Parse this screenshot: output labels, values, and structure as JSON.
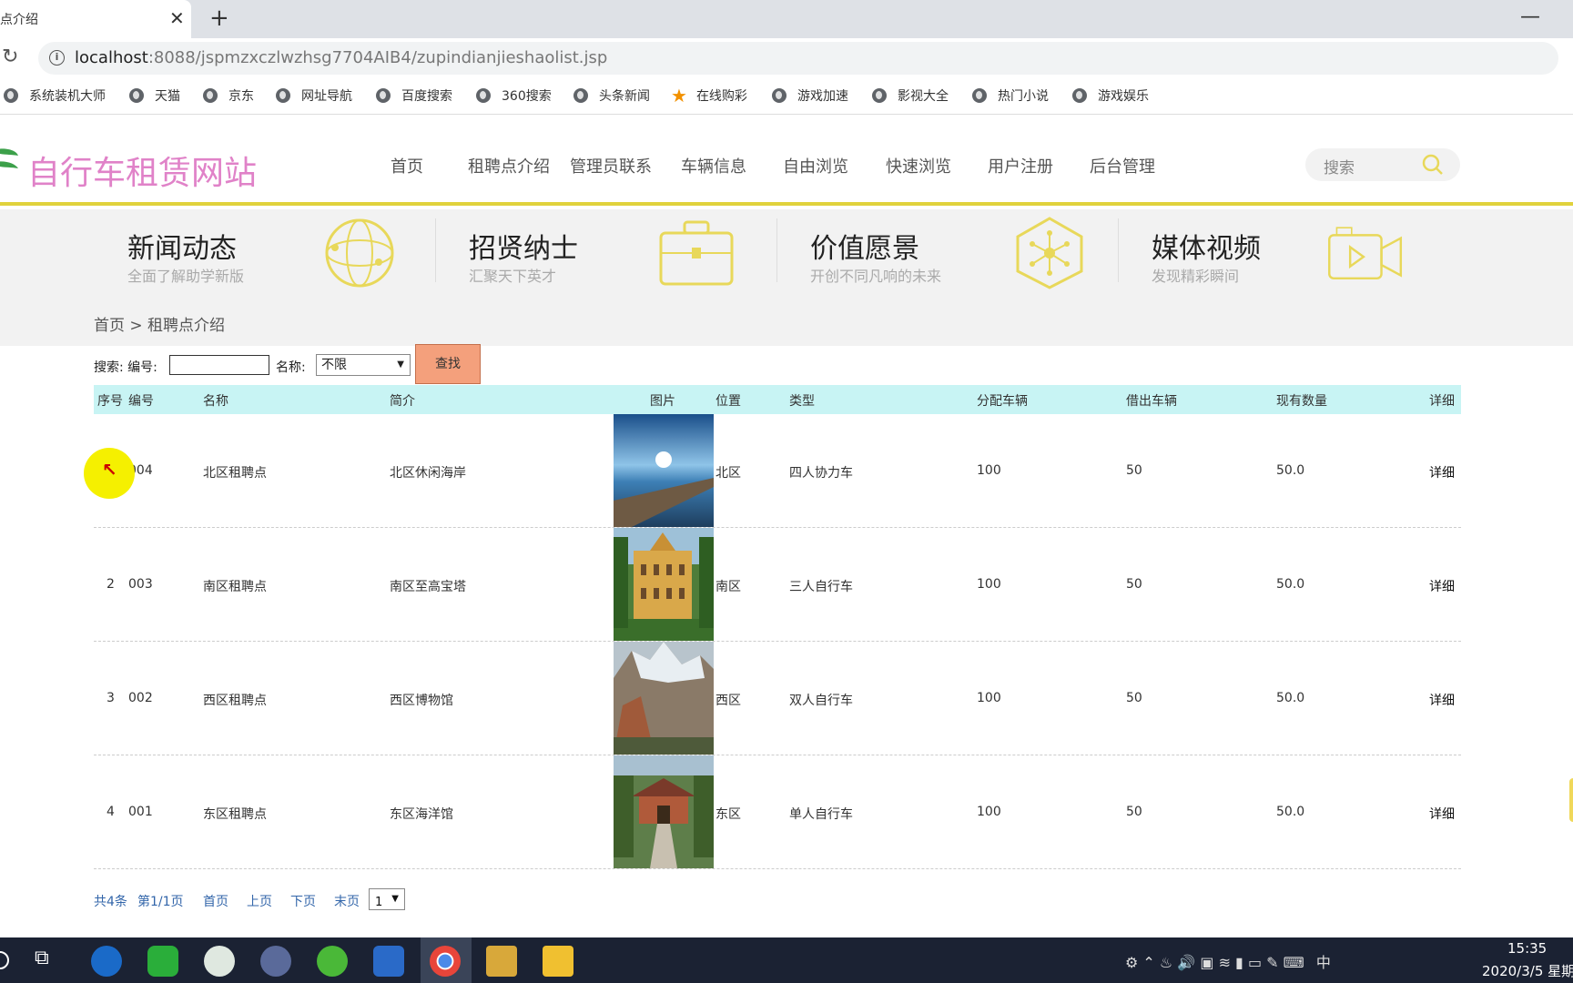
{
  "browser": {
    "tab_title": "点介绍",
    "url_host": "localhost",
    "url_rest": ":8088/jspmzxczlwzhsg7704AIB4/zupindianjieshaolist.jsp",
    "bookmarks": [
      "系统装机大师",
      "天猫",
      "京东",
      "网址导航",
      "百度搜索",
      "360搜索",
      "头条新闻",
      "在线购彩",
      "游戏加速",
      "影视大全",
      "热门小说",
      "游戏娱乐"
    ]
  },
  "site": {
    "title": "自行车租赁网站",
    "nav": [
      "首页",
      "租聘点介绍",
      "管理员联系",
      "车辆信息",
      "自由浏览",
      "快速浏览",
      "用户注册",
      "后台管理"
    ],
    "search_placeholder": "搜索"
  },
  "features": [
    {
      "title": "新闻动态",
      "subtitle": "全面了解助学新版",
      "icon": "globe-icon"
    },
    {
      "title": "招贤纳士",
      "subtitle": "汇聚天下英才",
      "icon": "briefcase-icon"
    },
    {
      "title": "价值愿景",
      "subtitle": "开创不同凡响的未来",
      "icon": "network-icon"
    },
    {
      "title": "媒体视频",
      "subtitle": "发现精彩瞬间",
      "icon": "video-camera-icon"
    }
  ],
  "breadcrumb": "首页 > 租聘点介绍",
  "search_form": {
    "label": "搜索: 编号:",
    "code_value": "",
    "name_label": "名称:",
    "name_selected": "不限",
    "button": "查找"
  },
  "table": {
    "headers": [
      "序号",
      "编号",
      "名称",
      "简介",
      "图片",
      "位置",
      "类型",
      "分配车辆",
      "借出车辆",
      "现有数量",
      "详细"
    ],
    "rows": [
      {
        "index": "1",
        "code": "004",
        "name": "北区租聘点",
        "intro": "北区休闲海岸",
        "location": "北区",
        "type": "四人协力车",
        "assigned": "100",
        "lent": "50",
        "available": "50.0",
        "detail": "详细",
        "image": "seaside-bridge"
      },
      {
        "index": "2",
        "code": "003",
        "name": "南区租聘点",
        "intro": "南区至高宝塔",
        "location": "南区",
        "type": "三人自行车",
        "assigned": "100",
        "lent": "50",
        "available": "50.0",
        "detail": "详细",
        "image": "yellow-palace"
      },
      {
        "index": "3",
        "code": "002",
        "name": "西区租聘点",
        "intro": "西区博物馆",
        "location": "西区",
        "type": "双人自行车",
        "assigned": "100",
        "lent": "50",
        "available": "50.0",
        "detail": "详细",
        "image": "snowy-cliff"
      },
      {
        "index": "4",
        "code": "001",
        "name": "东区租聘点",
        "intro": "东区海洋馆",
        "location": "东区",
        "type": "单人自行车",
        "assigned": "100",
        "lent": "50",
        "available": "50.0",
        "detail": "详细",
        "image": "temple-hill"
      }
    ]
  },
  "pager": {
    "total": "共4条",
    "page_info": "第1/1页",
    "first": "首页",
    "prev": "上页",
    "next": "下页",
    "last": "末页",
    "page_select": "1"
  },
  "taskbar": {
    "ime": "中",
    "time": "15:35",
    "date": "2020/3/5 星期"
  },
  "colors": {
    "accent_yellow": "#e0d23c",
    "site_title": "#e082c8",
    "table_header": "#c8f4f4",
    "search_button": "#f4a07c"
  }
}
